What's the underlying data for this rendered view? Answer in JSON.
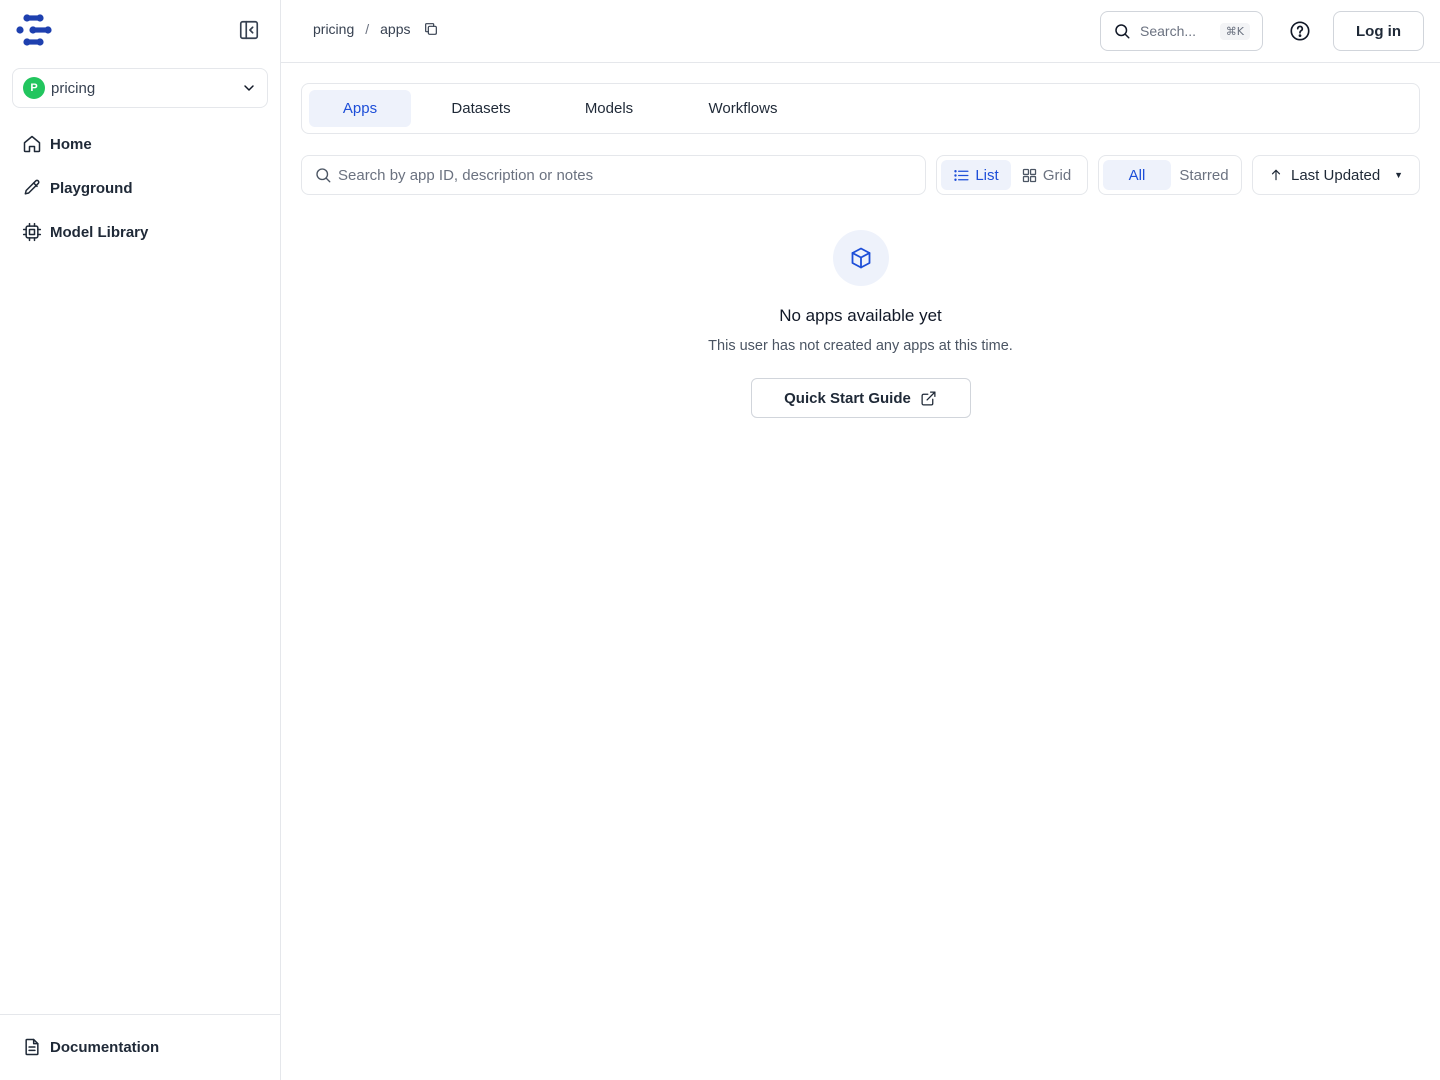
{
  "sidebar": {
    "org": {
      "initial": "P",
      "name": "pricing"
    },
    "items": [
      {
        "label": "Home",
        "icon": "home-icon"
      },
      {
        "label": "Playground",
        "icon": "pencil-icon"
      },
      {
        "label": "Model Library",
        "icon": "cpu-chip-icon"
      }
    ],
    "documentation": {
      "label": "Documentation",
      "icon": "document-icon"
    }
  },
  "topbar": {
    "breadcrumb": [
      "pricing",
      "apps"
    ],
    "separator": "/",
    "search_placeholder": "Search...",
    "search_shortcut": "⌘K",
    "login_label": "Log in"
  },
  "tabs": [
    {
      "label": "Apps",
      "active": true
    },
    {
      "label": "Datasets",
      "active": false
    },
    {
      "label": "Models",
      "active": false
    },
    {
      "label": "Workflows",
      "active": false
    }
  ],
  "toolbar": {
    "search_placeholder": "Search by app ID, description or notes",
    "view": {
      "list_label": "List",
      "grid_label": "Grid",
      "selected": "List"
    },
    "filter": {
      "all_label": "All",
      "starred_label": "Starred",
      "selected": "All"
    },
    "sort_label": "Last Updated"
  },
  "empty_state": {
    "title": "No apps available yet",
    "description": "This user has not created any apps at this time.",
    "button_label": "Quick Start Guide"
  },
  "colors": {
    "accent": "#1d4ed8",
    "accent_bg": "#eef2fb",
    "brand": "#1e40af",
    "org_avatar": "#22c55e",
    "border": "#e5e7eb"
  }
}
